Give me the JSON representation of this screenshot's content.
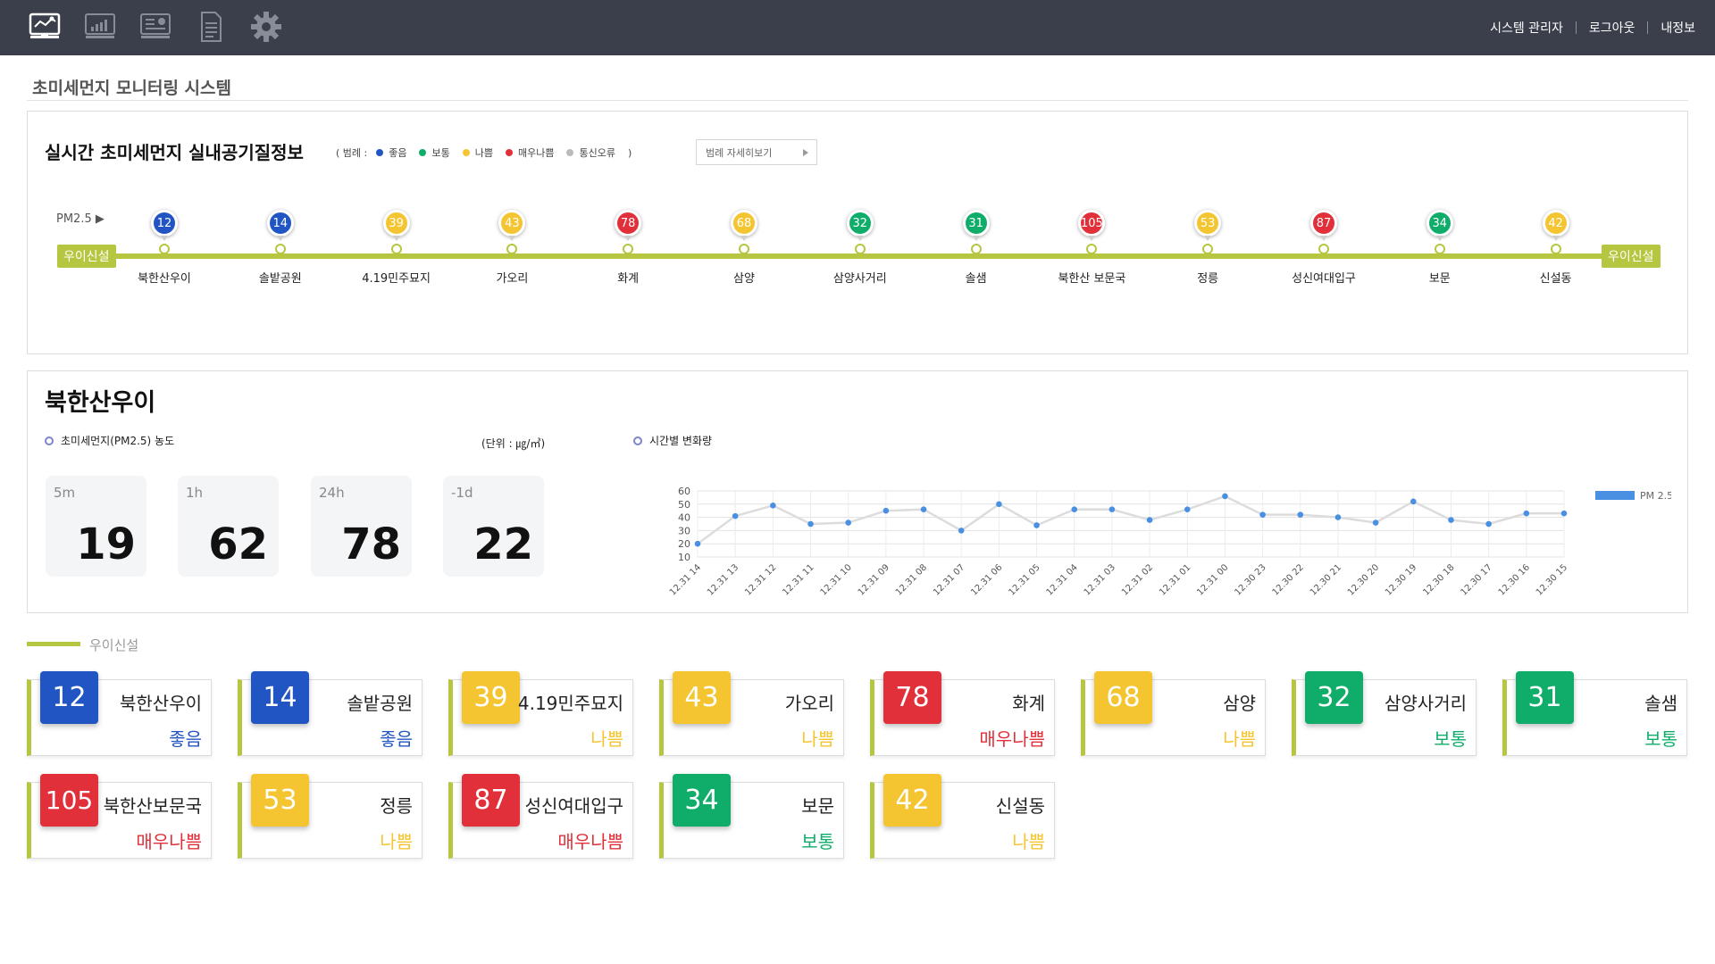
{
  "header": {
    "nav_icons": [
      {
        "name": "monitor-dashboard-icon"
      },
      {
        "name": "line-chart-icon"
      },
      {
        "name": "presentation-chart-icon"
      },
      {
        "name": "document-icon"
      },
      {
        "name": "gear-icon"
      }
    ],
    "links": [
      "시스템 관리자",
      "로그아웃",
      "내정보"
    ]
  },
  "page_title": "초미세먼지 모니터링 시스템",
  "realtime": {
    "title": "실시간 초미세먼지 실내공기질정보",
    "legend_open": "( 범례 :",
    "legend_close": ")",
    "legend": [
      {
        "label": "좋음",
        "color": "#2155c3"
      },
      {
        "label": "보통",
        "color": "#0fad69"
      },
      {
        "label": "나쁨",
        "color": "#f4c530"
      },
      {
        "label": "매우나쁨",
        "color": "#e1303a"
      },
      {
        "label": "통신오류",
        "color": "#bbbbbb"
      }
    ],
    "legend_button": "범례 자세히보기",
    "pm_label": "PM2.5 ▶",
    "line_name_left": "우이신설",
    "line_name_right": "우이신설",
    "stations": [
      {
        "name": "북한산우이",
        "value": "12",
        "level": "good"
      },
      {
        "name": "솔밭공원",
        "value": "14",
        "level": "good"
      },
      {
        "name": "4.19민주묘지",
        "value": "39",
        "level": "bad"
      },
      {
        "name": "가오리",
        "value": "43",
        "level": "bad"
      },
      {
        "name": "화계",
        "value": "78",
        "level": "verybad"
      },
      {
        "name": "삼양",
        "value": "68",
        "level": "bad"
      },
      {
        "name": "삼양사거리",
        "value": "32",
        "level": "normal"
      },
      {
        "name": "솔샘",
        "value": "31",
        "level": "normal"
      },
      {
        "name": "북한산 보문국",
        "value": "105",
        "level": "verybad"
      },
      {
        "name": "정릉",
        "value": "53",
        "level": "bad"
      },
      {
        "name": "성신여대입구",
        "value": "87",
        "level": "verybad"
      },
      {
        "name": "보문",
        "value": "34",
        "level": "normal"
      },
      {
        "name": "신설동",
        "value": "42",
        "level": "bad"
      }
    ]
  },
  "level_colors": {
    "good": "#2155c3",
    "normal": "#0fad69",
    "bad": "#f4c530",
    "verybad": "#e1303a",
    "error": "#bbbbbb"
  },
  "detail": {
    "station_title": "북한산우이",
    "concentration_label": "초미세먼지(PM2.5) 농도",
    "unit_label": "(단위 : ㎍/㎥)",
    "change_label": "시간별 변화량",
    "averages": [
      {
        "label": "5m",
        "value": "19"
      },
      {
        "label": "1h",
        "value": "62"
      },
      {
        "label": "24h",
        "value": "78"
      },
      {
        "label": "-1d",
        "value": "22"
      }
    ]
  },
  "chart_data": {
    "type": "line",
    "x": [
      "12.31 14",
      "12.31 13",
      "12.31 12",
      "12.31 11",
      "12.31 10",
      "12.31 09",
      "12.31 08",
      "12.31 07",
      "12.31 06",
      "12.31 05",
      "12.31 04",
      "12.31 03",
      "12.31 02",
      "12.31 01",
      "12.31 00",
      "12.30 23",
      "12.30 22",
      "12.30 21",
      "12.30 20",
      "12.30 19",
      "12.30 18",
      "12.30 17",
      "12.30 16",
      "12.30 15"
    ],
    "series": [
      {
        "name": "PM 2.5",
        "color": "#4a90e2",
        "values": [
          20,
          41,
          49,
          35,
          36,
          45,
          46,
          30,
          50,
          34,
          46,
          46,
          38,
          46,
          56,
          42,
          42,
          40,
          36,
          52,
          38,
          35,
          43,
          43
        ]
      }
    ],
    "yticks": [
      10,
      20,
      30,
      40,
      50,
      60
    ],
    "ylim": [
      10,
      60
    ],
    "grid": true,
    "legend_position": "top-right"
  },
  "section_label": "우이신설",
  "status_text": {
    "good": "좋음",
    "normal": "보통",
    "bad": "나쁨",
    "verybad": "매우나쁨"
  },
  "cards": [
    {
      "name": "북한산우이",
      "value": "12",
      "level": "good",
      "status": "좋음"
    },
    {
      "name": "솔밭공원",
      "value": "14",
      "level": "good",
      "status": "좋음"
    },
    {
      "name": "4.19민주묘지",
      "value": "39",
      "level": "bad",
      "status": "나쁨"
    },
    {
      "name": "가오리",
      "value": "43",
      "level": "bad",
      "status": "나쁨"
    },
    {
      "name": "화계",
      "value": "78",
      "level": "verybad",
      "status": "매우나쁨"
    },
    {
      "name": "삼양",
      "value": "68",
      "level": "bad",
      "status": "나쁨"
    },
    {
      "name": "삼양사거리",
      "value": "32",
      "level": "normal",
      "status": "보통"
    },
    {
      "name": "솔샘",
      "value": "31",
      "level": "normal",
      "status": "보통"
    },
    {
      "name": "북한산보문국",
      "value": "105",
      "level": "verybad",
      "status": "매우나쁨"
    },
    {
      "name": "정릉",
      "value": "53",
      "level": "bad",
      "status": "나쁨"
    },
    {
      "name": "성신여대입구",
      "value": "87",
      "level": "verybad",
      "status": "매우나쁨"
    },
    {
      "name": "보문",
      "value": "34",
      "level": "normal",
      "status": "보통"
    },
    {
      "name": "신설동",
      "value": "42",
      "level": "bad",
      "status": "나쁨"
    }
  ]
}
